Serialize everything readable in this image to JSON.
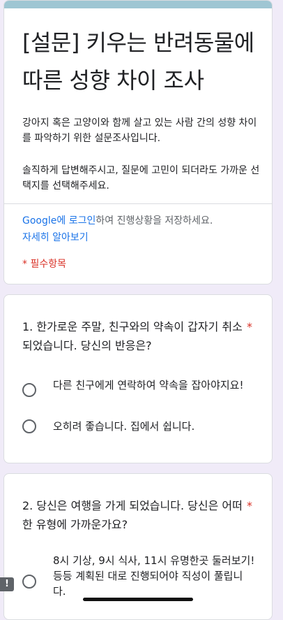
{
  "form": {
    "title": "[설문] 키우는 반려동물에 따른 성향 차이 조사",
    "description_1": "강아지 혹은 고양이와 함께 살고 있는 사람 간의 성향 차이를 파악하기 위한 설문조사입니다.",
    "description_2": "솔직하게 답변해주시고, 질문에 고민이 되더라도 가까운 선택지를 선택해주세요.",
    "login_brand": "Google",
    "login_link": "에 로그인",
    "login_suffix": "하여 진행상황을 저장하세요.",
    "learn_more": "자세히 알아보기",
    "required_note": "* 필수항목"
  },
  "questions": [
    {
      "title": "1. 한가로운 주말, 친구와의 약속이 갑자기 취소되었습니다. 당신의 반응은?",
      "required_mark": "*",
      "options": [
        "다른 친구에게 연락하여 약속을 잡아야지요!",
        "오히려 좋습니다. 집에서 쉽니다."
      ]
    },
    {
      "title": "2. 당신은 여행을 가게 되었습니다. 당신은 어떠한 유형에 가까운가요?",
      "required_mark": "*",
      "options": [
        "8시 기상, 9시 식사, 11시 유명한곳 둘러보기! 등등 계획된 대로 진행되어야 직성이 풀립니다."
      ]
    }
  ],
  "feedback_badge": "!",
  "colors": {
    "accent_bar": "#9fc6d3",
    "background": "#f0ebf8",
    "link": "#1a73e8",
    "required": "#d93025"
  }
}
